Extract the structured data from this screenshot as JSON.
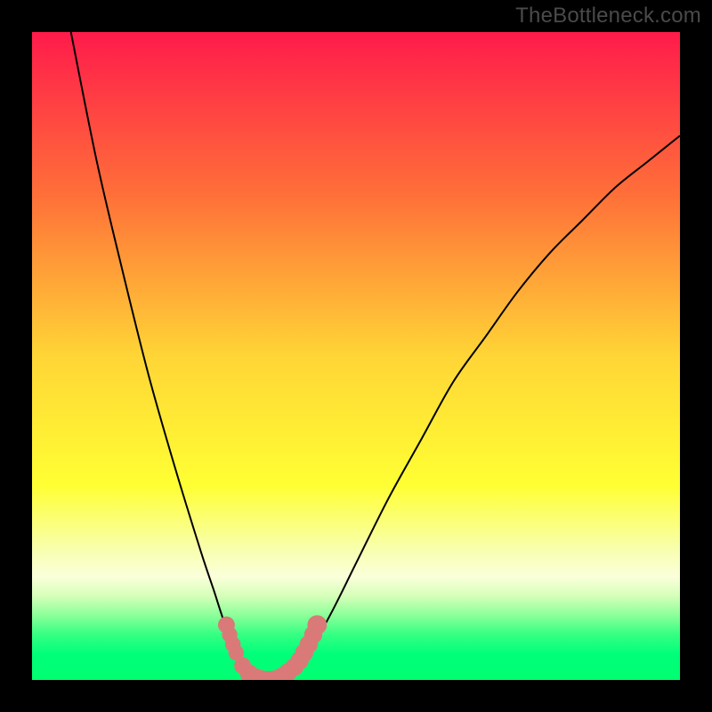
{
  "watermark": "TheBottleneck.com",
  "chart_data": {
    "type": "line",
    "title": "",
    "xlabel": "",
    "ylabel": "",
    "xlim": [
      0,
      100
    ],
    "ylim": [
      0,
      100
    ],
    "background_gradient": {
      "stops": [
        {
          "offset": 0.0,
          "color": "#ff1b4b"
        },
        {
          "offset": 0.25,
          "color": "#ff6f39"
        },
        {
          "offset": 0.5,
          "color": "#ffd536"
        },
        {
          "offset": 0.7,
          "color": "#ffff33"
        },
        {
          "offset": 0.8,
          "color": "#f8ffb0"
        },
        {
          "offset": 0.84,
          "color": "#fbffda"
        },
        {
          "offset": 0.87,
          "color": "#d6ffba"
        },
        {
          "offset": 0.9,
          "color": "#8cff9a"
        },
        {
          "offset": 0.93,
          "color": "#35ff82"
        },
        {
          "offset": 0.96,
          "color": "#00ff7a"
        },
        {
          "offset": 1.0,
          "color": "#00ff70"
        }
      ]
    },
    "green_band_y": [
      90,
      100
    ],
    "series": [
      {
        "name": "bottleneck-curve",
        "data": [
          {
            "x": 6,
            "y": 100
          },
          {
            "x": 10,
            "y": 80
          },
          {
            "x": 14,
            "y": 63
          },
          {
            "x": 18,
            "y": 47
          },
          {
            "x": 22,
            "y": 33
          },
          {
            "x": 26,
            "y": 20
          },
          {
            "x": 28,
            "y": 14
          },
          {
            "x": 30,
            "y": 8
          },
          {
            "x": 32,
            "y": 4
          },
          {
            "x": 34,
            "y": 1
          },
          {
            "x": 36,
            "y": 0
          },
          {
            "x": 38,
            "y": 0
          },
          {
            "x": 40,
            "y": 1
          },
          {
            "x": 42,
            "y": 3
          },
          {
            "x": 46,
            "y": 10
          },
          {
            "x": 50,
            "y": 18
          },
          {
            "x": 55,
            "y": 28
          },
          {
            "x": 60,
            "y": 37
          },
          {
            "x": 65,
            "y": 46
          },
          {
            "x": 70,
            "y": 53
          },
          {
            "x": 75,
            "y": 60
          },
          {
            "x": 80,
            "y": 66
          },
          {
            "x": 85,
            "y": 71
          },
          {
            "x": 90,
            "y": 76
          },
          {
            "x": 95,
            "y": 80
          },
          {
            "x": 100,
            "y": 84
          }
        ]
      }
    ],
    "markers": [
      {
        "x": 30.0,
        "y": 8.5,
        "r": 1.3
      },
      {
        "x": 30.5,
        "y": 7.0,
        "r": 1.2
      },
      {
        "x": 31.0,
        "y": 5.5,
        "r": 1.2
      },
      {
        "x": 31.5,
        "y": 4.2,
        "r": 1.2
      },
      {
        "x": 32.5,
        "y": 2.2,
        "r": 1.3
      },
      {
        "x": 33.5,
        "y": 1.0,
        "r": 1.4
      },
      {
        "x": 34.5,
        "y": 0.4,
        "r": 1.4
      },
      {
        "x": 35.5,
        "y": 0.1,
        "r": 1.4
      },
      {
        "x": 36.5,
        "y": 0.0,
        "r": 1.4
      },
      {
        "x": 37.5,
        "y": 0.1,
        "r": 1.4
      },
      {
        "x": 38.5,
        "y": 0.5,
        "r": 1.4
      },
      {
        "x": 39.5,
        "y": 1.2,
        "r": 1.4
      },
      {
        "x": 40.5,
        "y": 2.0,
        "r": 1.4
      },
      {
        "x": 41.3,
        "y": 3.0,
        "r": 1.4
      },
      {
        "x": 42.0,
        "y": 4.2,
        "r": 1.4
      },
      {
        "x": 42.7,
        "y": 5.5,
        "r": 1.4
      },
      {
        "x": 43.4,
        "y": 7.0,
        "r": 1.4
      },
      {
        "x": 44.0,
        "y": 8.5,
        "r": 1.5
      }
    ]
  }
}
